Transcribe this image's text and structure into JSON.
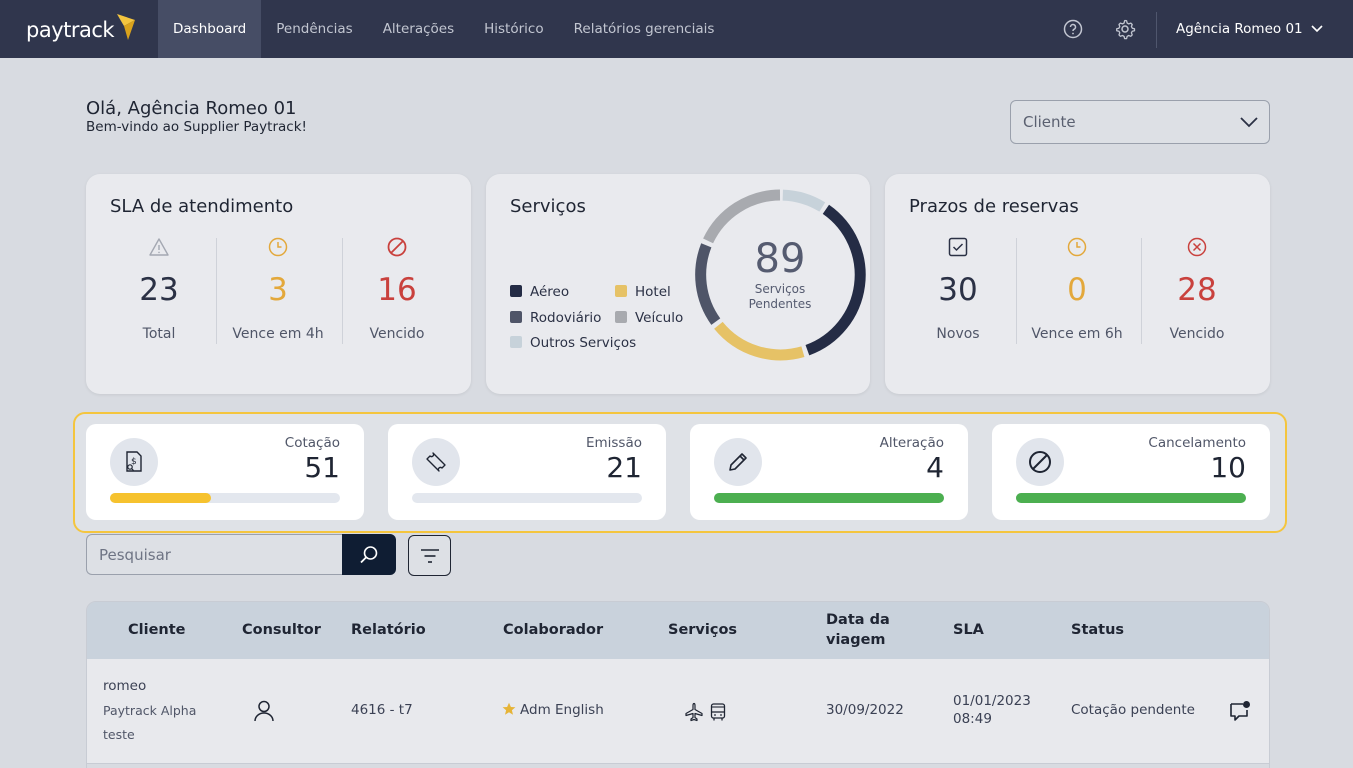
{
  "nav": {
    "logo": "paytrack",
    "items": [
      {
        "label": "Dashboard",
        "active": true
      },
      {
        "label": "Pendências",
        "active": false
      },
      {
        "label": "Alterações",
        "active": false
      },
      {
        "label": "Histórico",
        "active": false
      },
      {
        "label": "Relatórios gerenciais",
        "active": false
      }
    ],
    "agency": "Agência Romeo 01"
  },
  "greeting": {
    "title": "Olá, Agência Romeo 01",
    "subtitle": "Bem-vindo ao Supplier Paytrack!"
  },
  "client_select": {
    "value": "Cliente"
  },
  "sla": {
    "title": "SLA de atendimento",
    "stats": [
      {
        "value": "23",
        "label": "Total",
        "color": "#2b3145",
        "icon": "warning-icon"
      },
      {
        "value": "3",
        "label": "Vence em 4h",
        "color": "#e3a83b",
        "icon": "clock-icon"
      },
      {
        "value": "16",
        "label": "Vencido",
        "color": "#c9413d",
        "icon": "prohibited-icon"
      }
    ]
  },
  "services": {
    "title": "Serviços",
    "total": "89",
    "total_label_1": "Serviços",
    "total_label_2": "Pendentes",
    "legend": [
      {
        "label": "Aéreo",
        "color": "#242c45"
      },
      {
        "label": "Hotel",
        "color": "#e6c266"
      },
      {
        "label": "Rodoviário",
        "color": "#4f5568"
      },
      {
        "label": "Veículo",
        "color": "#a8aaaf"
      },
      {
        "label": "Outros Serviços",
        "color": "#c7d2da"
      }
    ]
  },
  "deadlines": {
    "title": "Prazos de reservas",
    "stats": [
      {
        "value": "30",
        "label": "Novos",
        "color": "#2b3145",
        "icon": "checkbox-icon"
      },
      {
        "value": "0",
        "label": "Vence em 6h",
        "color": "#e3a83b",
        "icon": "clock-icon"
      },
      {
        "value": "28",
        "label": "Vencido",
        "color": "#c9413d",
        "icon": "x-circle-icon"
      }
    ]
  },
  "types": [
    {
      "label": "Cotação",
      "count": "51",
      "progress": 0.44,
      "bar_color": "#f6c22e",
      "icon": "quote-document-icon"
    },
    {
      "label": "Emissão",
      "count": "21",
      "progress": 0.0,
      "bar_color": "#4caf50",
      "icon": "ticket-icon"
    },
    {
      "label": "Alteração",
      "count": "4",
      "progress": 1.0,
      "bar_color": "#4caf50",
      "icon": "pencil-icon"
    },
    {
      "label": "Cancelamento",
      "count": "10",
      "progress": 1.0,
      "bar_color": "#4caf50",
      "icon": "prohibited-icon"
    }
  ],
  "search": {
    "placeholder": "Pesquisar"
  },
  "table": {
    "headers": [
      "Cliente",
      "Consultor",
      "Relatório",
      "Colaborador",
      "Serviços",
      "Data da",
      "viagem",
      "SLA",
      "Status"
    ],
    "rows": [
      {
        "client": "romeo",
        "client_company": "Paytrack Alpha",
        "client_note": "teste",
        "report": "4616 - t7",
        "collaborator": "Adm English",
        "trip_date": "30/09/2022",
        "sla_date": "01/01/2023",
        "sla_time": "08:49",
        "status": "Cotação pendente"
      }
    ]
  }
}
